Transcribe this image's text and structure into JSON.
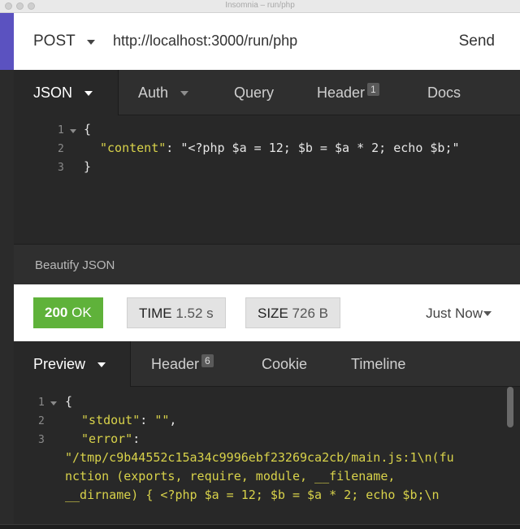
{
  "window": {
    "title": "Insomnia – run/php"
  },
  "request": {
    "method": "POST",
    "url": "http://localhost:3000/run/php",
    "send_label": "Send",
    "tabs": [
      {
        "label": "JSON"
      },
      {
        "label": "Auth"
      },
      {
        "label": "Query"
      },
      {
        "label": "Header",
        "badge": "1"
      },
      {
        "label": "Docs"
      }
    ],
    "body_lines": [
      {
        "num": "1",
        "text": "{"
      },
      {
        "num": "2",
        "key": "\"content\"",
        "sep": ": ",
        "value": "\"<?php $a = 12; $b = $a * 2; echo $b;\""
      },
      {
        "num": "3",
        "text": "}"
      }
    ],
    "beautify_label": "Beautify JSON"
  },
  "response": {
    "status_code": "200",
    "status_text": "OK",
    "time_label": "TIME",
    "time_value": "1.52 s",
    "size_label": "SIZE",
    "size_value": "726 B",
    "history_label": "Just Now",
    "tabs": [
      {
        "label": "Preview"
      },
      {
        "label": "Header",
        "badge": "6"
      },
      {
        "label": "Cookie"
      },
      {
        "label": "Timeline"
      }
    ],
    "body_lines": [
      {
        "num": "1",
        "text": "{"
      },
      {
        "num": "2",
        "key": "\"stdout\"",
        "sep": ": ",
        "value": "\"\"",
        "tail": ","
      },
      {
        "num": "3",
        "key": "\"error\"",
        "sep": ":"
      },
      {
        "num": "",
        "value": "\"/tmp/c9b44552c15a34c9996ebf23269ca2cb/main.js:1\\n(fu"
      },
      {
        "num": "",
        "value": "nction (exports, require, module, __filename,"
      },
      {
        "num": "",
        "value": "__dirname) { <?php $a = 12; $b = $a * 2; echo $b;\\n"
      }
    ]
  },
  "colors": {
    "accent": "#5b52c0",
    "status_ok": "#5fb23a",
    "string": "#d8d24a",
    "panel_bg": "#282828"
  }
}
